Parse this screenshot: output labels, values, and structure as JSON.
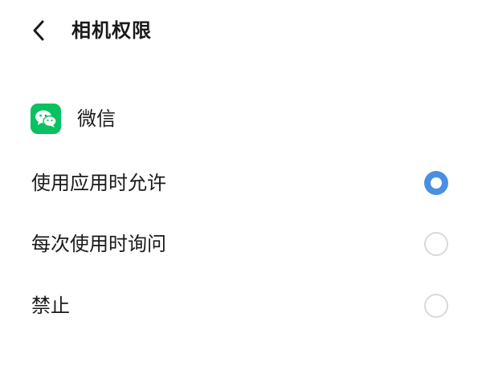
{
  "header": {
    "title": "相机权限",
    "back_icon": "chevron-left-icon"
  },
  "app": {
    "name": "微信",
    "icon": "wechat-icon",
    "icon_color": "#09C160"
  },
  "options": [
    {
      "label": "使用应用时允许",
      "selected": true
    },
    {
      "label": "每次使用时询问",
      "selected": false
    },
    {
      "label": "禁止",
      "selected": false
    }
  ],
  "colors": {
    "accent": "#4A90E2",
    "radio_unselected": "#D9D9D9"
  }
}
